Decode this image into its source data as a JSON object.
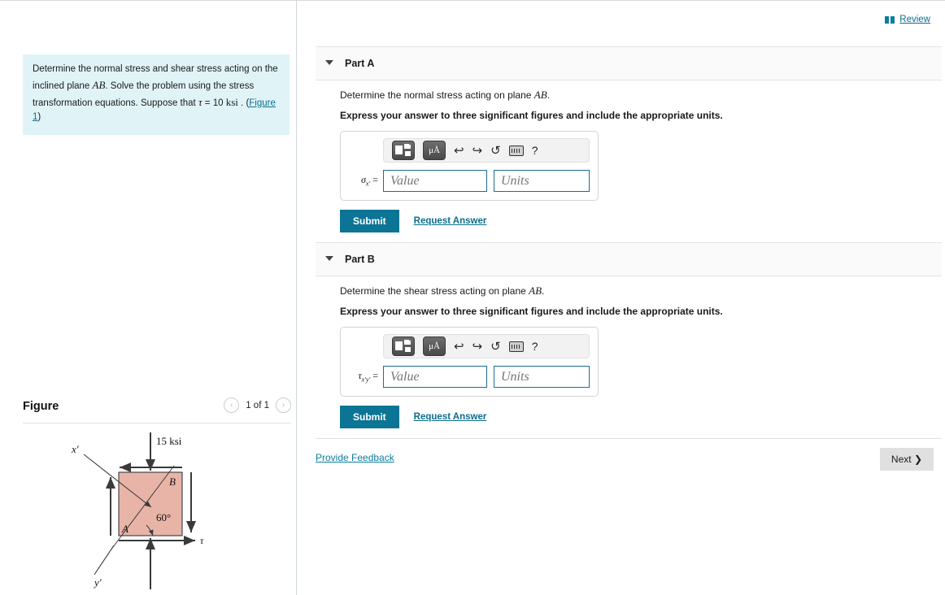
{
  "left": {
    "problem": {
      "line1": "Determine the normal stress and shear stress acting on the",
      "line2_pre": "inclined plane ",
      "line2_math": "AB",
      "line2_post": ". Solve the problem using the stress",
      "line3_pre": "transformation equations. Suppose that ",
      "line3_tau": "τ",
      "line3_eq": " = 10 ",
      "line3_unit": "ksi",
      "line3_post": " . (",
      "figure_link": "Figure 1",
      "line3_end": ")"
    },
    "figure": {
      "title": "Figure",
      "pager_label": "1 of 1",
      "prev_icon": "‹",
      "next_icon": "›",
      "labels": {
        "top_stress": "15 ksi",
        "x_prime": "x′",
        "y_prime": "y′",
        "corner_a": "A",
        "corner_b": "B",
        "angle": "60°",
        "tau": "τ"
      },
      "colors": {
        "element_fill": "#e8b4a8",
        "element_stroke": "#3a3a3a"
      }
    }
  },
  "right": {
    "review": {
      "label": "Review",
      "icon": "book-icon"
    },
    "parts": [
      {
        "id": "A",
        "header": "Part A",
        "question_pre": "Determine the normal stress acting on plane ",
        "question_math": "AB",
        "question_post": ".",
        "instruction": "Express your answer to three significant figures and include the appropriate units.",
        "symbol_base": "σ",
        "symbol_sub": "x′",
        "equals": "=",
        "value_placeholder": "Value",
        "units_placeholder": "Units",
        "value": "",
        "units": "",
        "submit_label": "Submit",
        "request_label": "Request Answer"
      },
      {
        "id": "B",
        "header": "Part B",
        "question_pre": "Determine the shear stress acting on plane ",
        "question_math": "AB",
        "question_post": ".",
        "instruction": "Express your answer to three significant figures and include the appropriate units.",
        "symbol_base": "τ",
        "symbol_sub": "x′y′",
        "equals": "=",
        "value_placeholder": "Value",
        "units_placeholder": "Units",
        "value": "",
        "units": "",
        "submit_label": "Submit",
        "request_label": "Request Answer"
      }
    ],
    "toolbar": {
      "template_icon": "template-icon",
      "units_label": "μÅ",
      "undo_icon": "↩",
      "redo_icon": "↪",
      "reset_icon": "↺",
      "keyboard_icon": "keyboard-icon",
      "help_icon": "?"
    },
    "footer": {
      "provide_feedback": "Provide Feedback",
      "next_label": "Next",
      "next_chevron": "❯"
    }
  },
  "colors": {
    "accent_teal": "#0c7595",
    "link_teal": "#0b7d9e",
    "problem_bg": "#e0f4f7",
    "part_header_bg": "#fafafa",
    "input_border": "#1a6f8f"
  }
}
